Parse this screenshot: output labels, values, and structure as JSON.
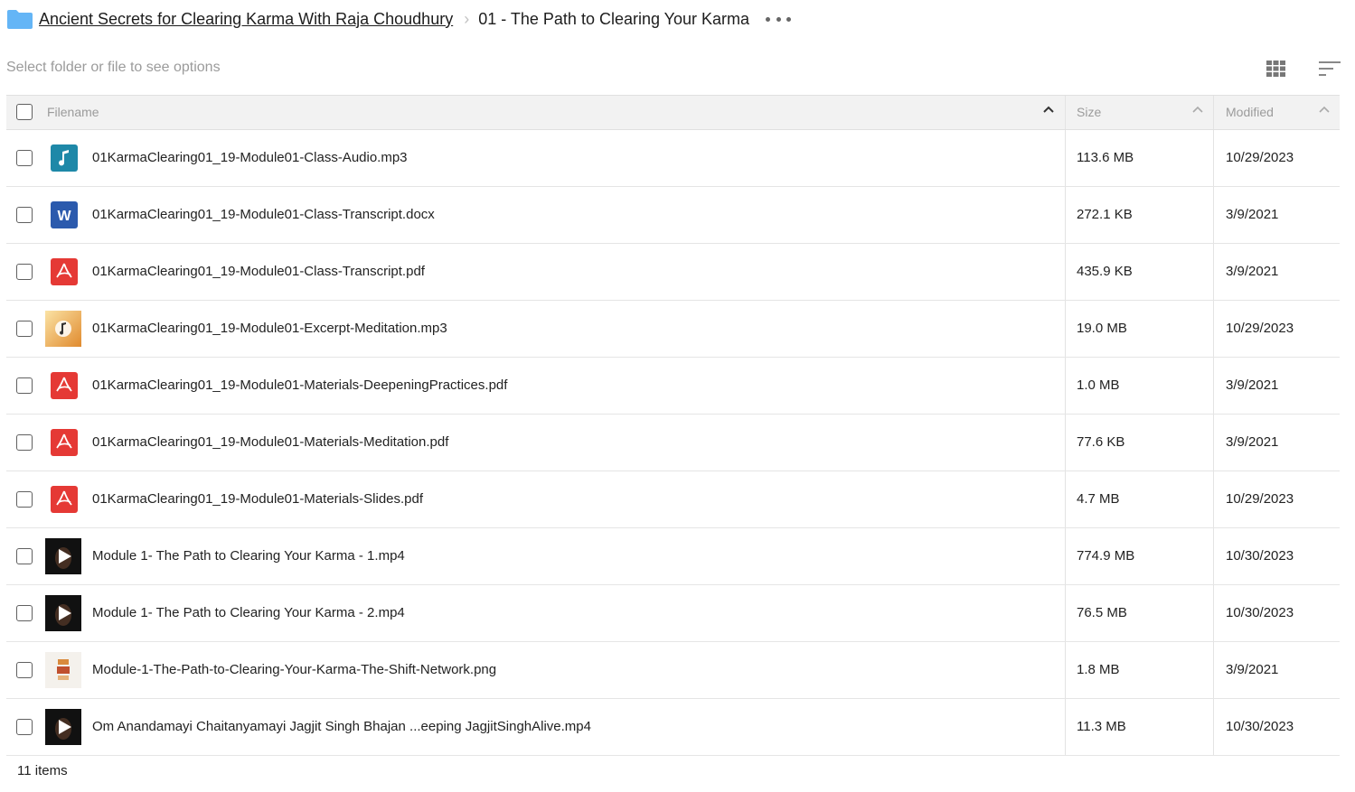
{
  "breadcrumb": {
    "parent": "Ancient Secrets for Clearing Karma With Raja Choudhury",
    "current": "01 - The Path to Clearing Your Karma"
  },
  "toolbar": {
    "hint": "Select folder or file to see options",
    "view_icon": "grid-view-icon",
    "sort_icon": "sort-icon"
  },
  "columns": {
    "filename": "Filename",
    "size": "Size",
    "modified": "Modified"
  },
  "colors": {
    "folder": "#64b5f6",
    "audio": "#1e88a8",
    "word": "#2b5aad",
    "pdf": "#e53935"
  },
  "files": [
    {
      "name": "01KarmaClearing01_19-Module01-Class-Audio.mp3",
      "size": "113.6 MB",
      "modified": "10/29/2023",
      "icon": "audio-file-icon"
    },
    {
      "name": "01KarmaClearing01_19-Module01-Class-Transcript.docx",
      "size": "272.1 KB",
      "modified": "3/9/2021",
      "icon": "word-file-icon"
    },
    {
      "name": "01KarmaClearing01_19-Module01-Class-Transcript.pdf",
      "size": "435.9 KB",
      "modified": "3/9/2021",
      "icon": "pdf-file-icon"
    },
    {
      "name": "01KarmaClearing01_19-Module01-Excerpt-Meditation.mp3",
      "size": "19.0 MB",
      "modified": "10/29/2023",
      "icon": "audio-thumbnail-icon"
    },
    {
      "name": "01KarmaClearing01_19-Module01-Materials-DeepeningPractices.pdf",
      "size": "1.0 MB",
      "modified": "3/9/2021",
      "icon": "pdf-file-icon"
    },
    {
      "name": "01KarmaClearing01_19-Module01-Materials-Meditation.pdf",
      "size": "77.6 KB",
      "modified": "3/9/2021",
      "icon": "pdf-file-icon"
    },
    {
      "name": "01KarmaClearing01_19-Module01-Materials-Slides.pdf",
      "size": "4.7 MB",
      "modified": "10/29/2023",
      "icon": "pdf-file-icon"
    },
    {
      "name": "Module 1- The Path to Clearing Your Karma - 1.mp4",
      "size": "774.9 MB",
      "modified": "10/30/2023",
      "icon": "video-thumbnail-icon"
    },
    {
      "name": "Module 1- The Path to Clearing Your Karma - 2.mp4",
      "size": "76.5 MB",
      "modified": "10/30/2023",
      "icon": "video-thumbnail-icon"
    },
    {
      "name": "Module-1-The-Path-to-Clearing-Your-Karma-The-Shift-Network.png",
      "size": "1.8 MB",
      "modified": "3/9/2021",
      "icon": "image-thumbnail-icon"
    },
    {
      "name": "Om Anandamayi Chaitanyamayi Jagjit Singh Bhajan ...eeping JagjitSinghAlive.mp4",
      "size": "11.3 MB",
      "modified": "10/30/2023",
      "icon": "video-thumbnail-icon"
    }
  ],
  "footer": {
    "count": "11 items"
  }
}
